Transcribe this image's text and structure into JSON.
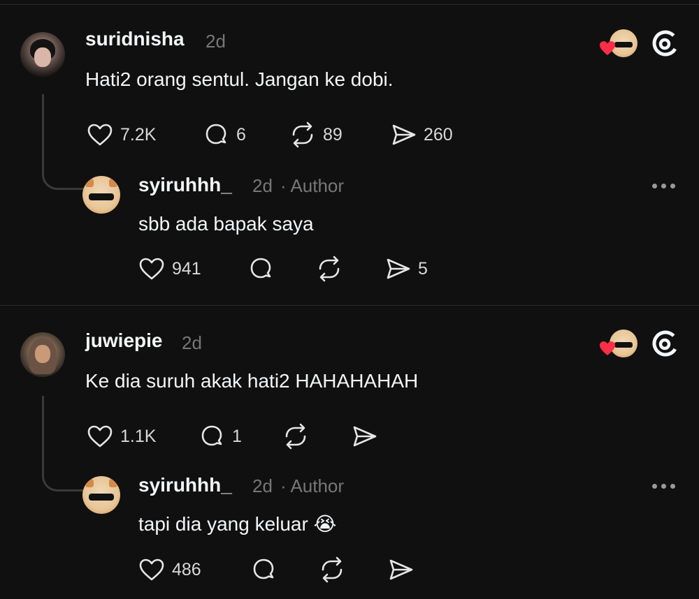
{
  "posts": [
    {
      "author": "suridnisha",
      "time": "2d",
      "text": "Hati2 orang sentul. Jangan ke dobi.",
      "likes": "7.2K",
      "replies": "6",
      "reposts": "89",
      "shares": "260",
      "reply": {
        "author": "syiruhhh_",
        "time": "2d",
        "tag": "· Author",
        "text": "sbb ada bapak saya",
        "likes": "941",
        "shares": "5"
      }
    },
    {
      "author": "juwiepie",
      "time": "2d",
      "text": "Ke dia suruh akak hati2 HAHAHAHAH",
      "likes": "1.1K",
      "replies": "1",
      "reply": {
        "author": "syiruhhh_",
        "time": "2d",
        "tag": "· Author",
        "text": "tapi dia yang keluar",
        "emoji": "😭",
        "likes": "486"
      }
    }
  ],
  "icons": [
    "heart-icon",
    "comment-icon",
    "repost-icon",
    "share-icon",
    "threads-logo-icon",
    "more-icon"
  ],
  "colors": {
    "background": "#101010",
    "text": "#f3f5f7",
    "muted": "#777777",
    "like_badge": "#ff2d47"
  }
}
